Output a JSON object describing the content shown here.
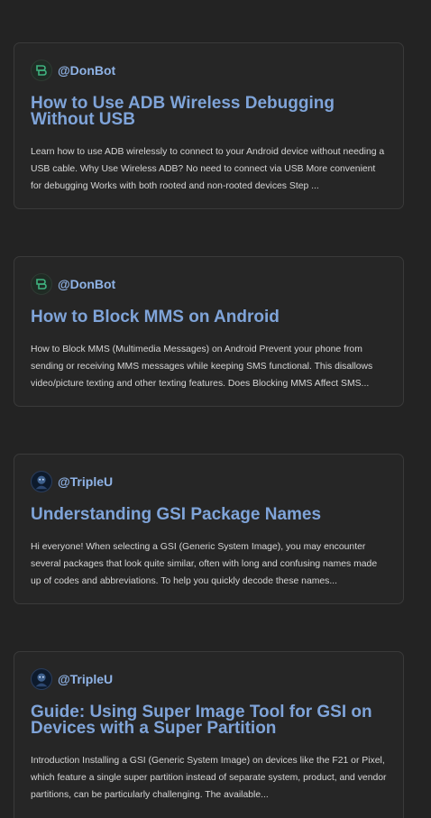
{
  "posts": [
    {
      "author": "@DonBot",
      "avatar_icon": "donbot-logo-icon",
      "title": "How to Use ADB Wireless Debugging Without USB",
      "excerpt": "Learn how to use ADB wirelessly to connect to your Android device without needing a USB cable. Why Use Wireless ADB? No need to connect via USB More convenient for debugging Works with both rooted and non-rooted devices Step ..."
    },
    {
      "author": "@DonBot",
      "avatar_icon": "donbot-logo-icon",
      "title": "How to Block MMS on Android",
      "excerpt": "How to Block MMS (Multimedia Messages) on Android Prevent your phone from sending or receiving MMS messages while keeping SMS functional. This disallows video/picture texting and other texting features. Does Blocking MMS Affect SMS..."
    },
    {
      "author": "@TripleU",
      "avatar_icon": "tripleu-avatar-icon",
      "title": "Understanding GSI Package Names",
      "excerpt": "Hi everyone! When selecting a GSI (Generic System Image), you may encounter several packages that look quite similar, often with long and confusing names made up of codes and abbreviations. To help you quickly decode these names..."
    },
    {
      "author": "@TripleU",
      "avatar_icon": "tripleu-avatar-icon",
      "title": "Guide: Using Super Image Tool for GSI on Devices with a Super Partition",
      "excerpt": "Introduction Installing a GSI (Generic System Image) on devices like the F21 or Pixel, which feature a single super partition instead of separate system, product, and vendor partitions, can be particularly challenging. The available..."
    }
  ],
  "colors": {
    "background": "#232323",
    "card": "#262626",
    "card_border": "#3a3a3a",
    "author": "#8fb3e6",
    "title": "#7fa4d9",
    "excerpt": "#d6d6d6",
    "donbot_logo": "#3fb27f"
  }
}
